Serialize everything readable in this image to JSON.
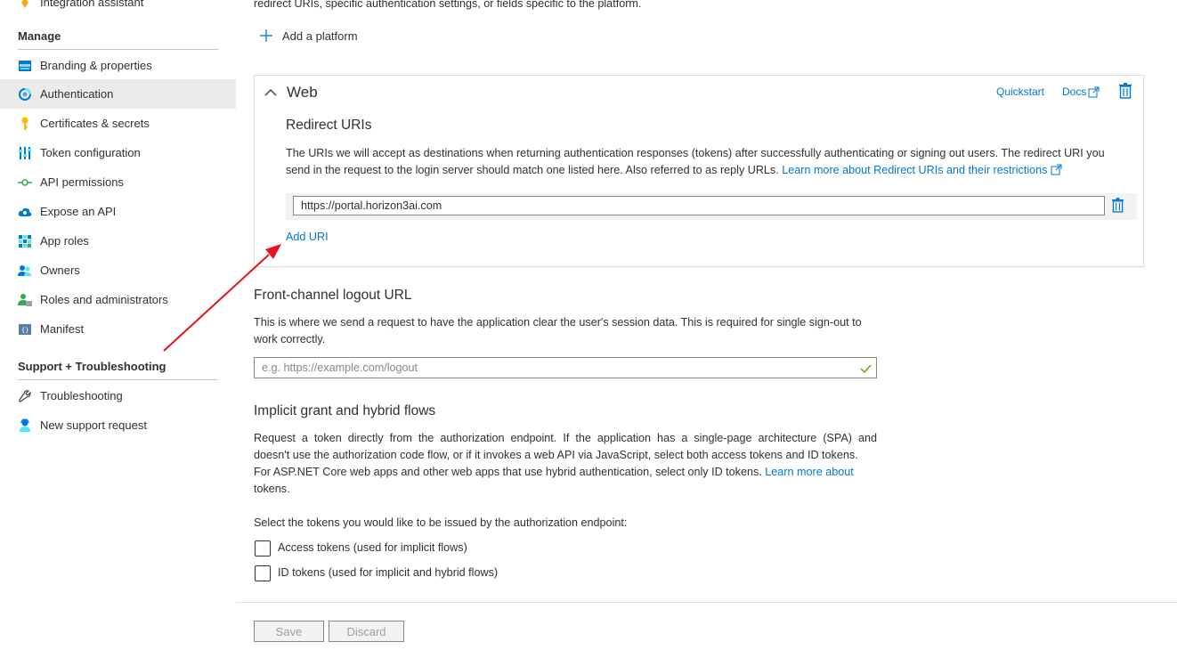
{
  "sidebar": {
    "top_item": "Integration assistant",
    "manage_heading": "Manage",
    "items": [
      {
        "label": "Branding & properties",
        "icon": "branding-icon"
      },
      {
        "label": "Authentication",
        "icon": "authentication-icon",
        "active": true
      },
      {
        "label": "Certificates & secrets",
        "icon": "key-icon"
      },
      {
        "label": "Token configuration",
        "icon": "token-config-icon"
      },
      {
        "label": "API permissions",
        "icon": "api-permissions-icon"
      },
      {
        "label": "Expose an API",
        "icon": "cloud-icon"
      },
      {
        "label": "App roles",
        "icon": "app-roles-icon"
      },
      {
        "label": "Owners",
        "icon": "owners-icon"
      },
      {
        "label": "Roles and administrators",
        "icon": "roles-icon"
      },
      {
        "label": "Manifest",
        "icon": "manifest-icon"
      }
    ],
    "support_heading": "Support + Troubleshooting",
    "support_items": [
      {
        "label": "Troubleshooting",
        "icon": "wrench-icon"
      },
      {
        "label": "New support request",
        "icon": "support-person-icon"
      }
    ]
  },
  "main": {
    "intro_tail": "redirect URIs, specific authentication settings, or fields specific to the platform.",
    "add_platform": "Add a platform",
    "web": {
      "title": "Web",
      "quickstart": "Quickstart",
      "docs": "Docs",
      "redirect_heading": "Redirect URIs",
      "redirect_desc_line1": "The URIs we will accept as destinations when returning authentication responses (tokens) after successfully authenticating or signing out users. The redirect URI you",
      "redirect_desc_line2": "send in the request to the login server should match one listed here. Also referred to as reply URLs.",
      "redirect_link": "Learn more about Redirect URIs and their restrictions",
      "uri_value": "https://portal.horizon3ai.com",
      "add_uri": "Add URI"
    },
    "logout": {
      "heading": "Front-channel logout URL",
      "desc_line1": "This is where we send a request to have the application clear the user's session data. This is required for single sign-out to",
      "desc_line2": "work correctly.",
      "placeholder": "e.g. https://example.com/logout"
    },
    "implicit": {
      "heading": "Implicit grant and hybrid flows",
      "desc_line1": "Request a token directly from the authorization endpoint. If the application has a single-page architecture (SPA) and",
      "desc_line2": "doesn't use the authorization code flow, or if it invokes a web API via JavaScript, select both access tokens and ID tokens.",
      "desc_line3": "For ASP.NET Core web apps and other web apps that use hybrid authentication, select only ID tokens.",
      "link_a": "Learn more about",
      "link_b": "tokens.",
      "select_label": "Select the tokens you would like to be issued by the authorization endpoint:",
      "access_tokens": "Access tokens (used for implicit flows)",
      "id_tokens": "ID tokens (used for implicit and hybrid flows)"
    },
    "save": "Save",
    "discard": "Discard"
  },
  "colors": {
    "accent": "#0078d4",
    "annotation_arrow": "#e81123",
    "active_bg": "#edebe9"
  }
}
